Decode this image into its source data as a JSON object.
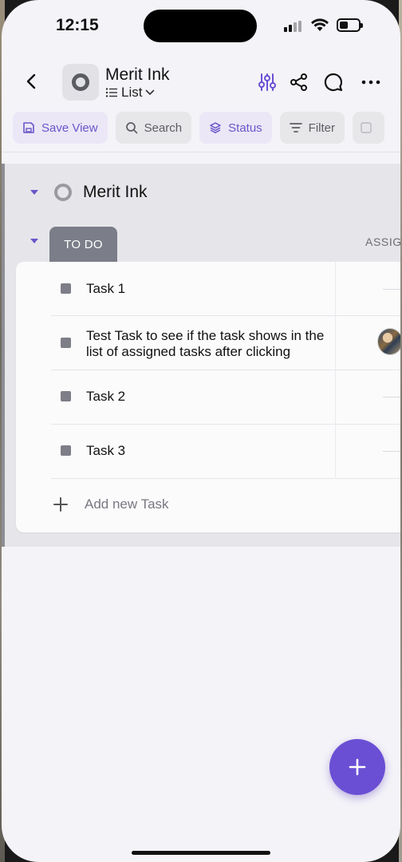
{
  "status_bar": {
    "time": "12:15"
  },
  "header": {
    "title": "Merit Ink",
    "view_label": "List"
  },
  "toolbar": {
    "save_view": "Save View",
    "search": "Search",
    "status": "Status",
    "filter": "Filter"
  },
  "group": {
    "space_name": "Merit Ink",
    "status_tab": "TO DO",
    "assignee_header": "ASSIG"
  },
  "tasks": [
    {
      "name": "Task 1",
      "assigned": false
    },
    {
      "name": "Test Task to see if the task shows in the list of assigned tasks after clicking",
      "assigned": true
    },
    {
      "name": "Task 2",
      "assigned": false
    },
    {
      "name": "Task 3",
      "assigned": false
    }
  ],
  "add_task_label": "Add new Task",
  "colors": {
    "accent": "#6a4fd4",
    "chip_purple_bg": "#ebe7f7",
    "status_tab_bg": "#7b7e89"
  },
  "icons": [
    "back-icon",
    "list-icon",
    "chevron-down-icon",
    "sliders-icon",
    "share-icon",
    "comment-icon",
    "more-icon",
    "save-icon",
    "search-icon",
    "layers-icon",
    "filter-icon",
    "plus-icon"
  ]
}
